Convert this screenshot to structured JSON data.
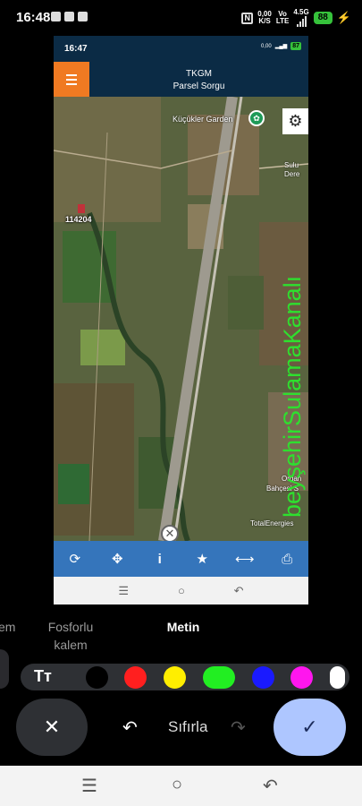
{
  "status": {
    "time": "16:48",
    "net_speed_value": "0,00",
    "net_speed_unit": "K/S",
    "vo": "Vo",
    "lte": "LTE",
    "net_type": "4.5G",
    "battery": "88"
  },
  "app": {
    "status": {
      "time": "16:47",
      "net_speed": "0,00",
      "battery": "87"
    },
    "title": "TKGM",
    "subtitle": "Parsel Sorgu",
    "map": {
      "place_label": "Küçükler Garden",
      "parcel_number": "114204",
      "overlay_text": "beyşehirSulamaKanalı",
      "label_sulu_dere": "Sulu Dere",
      "label_organik_1": "Organ",
      "label_organik_2": "Bahçesi S",
      "label_total": "TotalEnergies"
    },
    "toolbar": [
      "refresh",
      "locate",
      "info",
      "favorite",
      "measure",
      "print"
    ]
  },
  "editor": {
    "tool_left_partial": "em",
    "tool_highlighter_line1": "Fosforlu",
    "tool_highlighter_line2": "kalem",
    "tool_text": "Metin",
    "text_style_glyph": "Tт",
    "colors": [
      "#000000",
      "#ff1f1f",
      "#ffee00",
      "#22ee22",
      "#1a1aff",
      "#ff16ee",
      "#ffffff"
    ],
    "selected_color": "#22ee22",
    "reset_label": "Sıfırla"
  }
}
